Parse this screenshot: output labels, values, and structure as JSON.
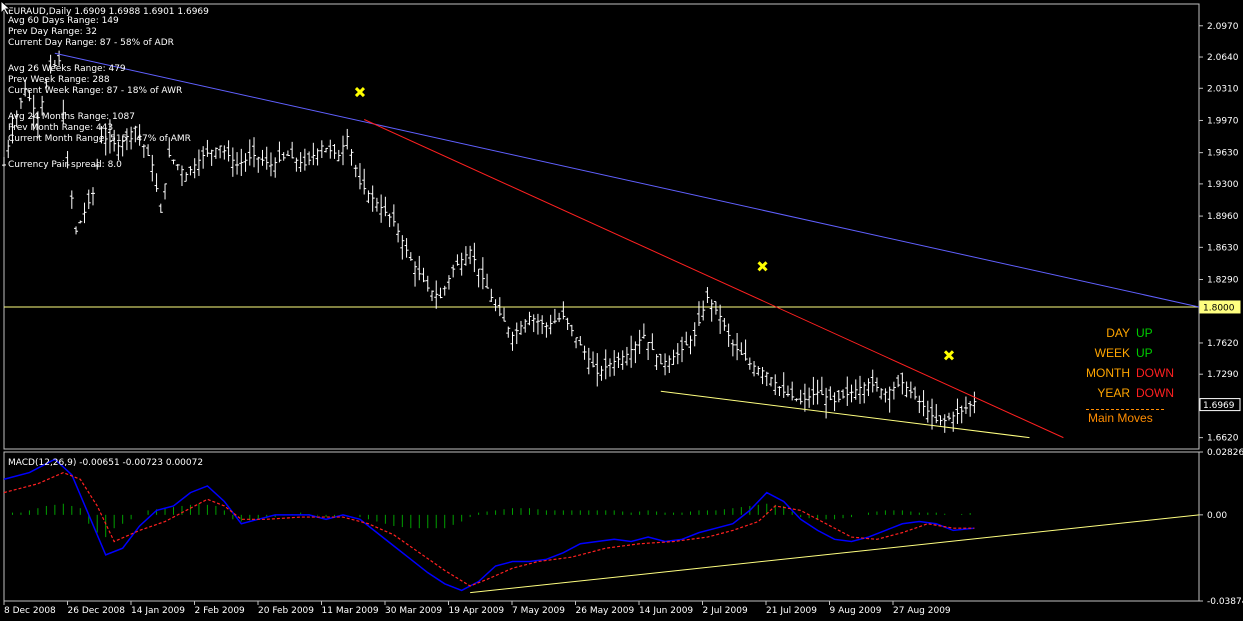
{
  "chart_data": [
    {
      "type": "ohlc",
      "title": "EURAUD,Daily  1.6909 1.6988 1.6901 1.6969",
      "symbol": "EURAUD",
      "timeframe": "Daily",
      "last_bar": {
        "open": 1.6909,
        "high": 1.6988,
        "low": 1.6901,
        "close": 1.6969
      },
      "y_ticks": [
        "2.0970",
        "2.0640",
        "2.0310",
        "1.9970",
        "1.9630",
        "1.9300",
        "1.8960",
        "1.8630",
        "1.8290",
        "1.7620",
        "1.7290",
        "1.6620"
      ],
      "ylim": [
        1.65,
        2.12
      ],
      "highlight_levels": [
        {
          "label": "1.8000",
          "value": 1.8,
          "color": "#ffff80"
        },
        {
          "label": "1.6969",
          "value": 1.6969,
          "color": "#ffffff"
        }
      ],
      "x_tick_labels": [
        "8 Dec 2008",
        "26 Dec 2008",
        "14 Jan 2009",
        "2 Feb 2009",
        "20 Feb 2009",
        "11 Mar 2009",
        "30 Mar 2009",
        "19 Apr 2009",
        "7 May 2009",
        "26 May 2009",
        "14 Jun 2009",
        "2 Jul 2009",
        "21 Jul 2009",
        "9 Aug 2009",
        "27 Aug 2009"
      ],
      "x_range_days": [
        0,
        282
      ],
      "series_path": [
        [
          0,
          1.95
        ],
        [
          2,
          1.99
        ],
        [
          5,
          2.03
        ],
        [
          8,
          2.0
        ],
        [
          11,
          2.05
        ],
        [
          13,
          2.06
        ],
        [
          15,
          1.95
        ],
        [
          17,
          1.88
        ],
        [
          19,
          1.9
        ],
        [
          21,
          1.92
        ],
        [
          23,
          1.98
        ],
        [
          27,
          1.97
        ],
        [
          31,
          1.99
        ],
        [
          35,
          1.95
        ],
        [
          37,
          1.9
        ],
        [
          39,
          1.96
        ],
        [
          43,
          1.94
        ],
        [
          47,
          1.96
        ],
        [
          51,
          1.97
        ],
        [
          55,
          1.95
        ],
        [
          59,
          1.96
        ],
        [
          63,
          1.95
        ],
        [
          67,
          1.96
        ],
        [
          71,
          1.95
        ],
        [
          75,
          1.97
        ],
        [
          79,
          1.96
        ],
        [
          81,
          1.98
        ],
        [
          84,
          1.93
        ],
        [
          88,
          1.91
        ],
        [
          92,
          1.89
        ],
        [
          96,
          1.85
        ],
        [
          100,
          1.82
        ],
        [
          103,
          1.81
        ],
        [
          106,
          1.84
        ],
        [
          110,
          1.86
        ],
        [
          113,
          1.83
        ],
        [
          116,
          1.8
        ],
        [
          120,
          1.77
        ],
        [
          124,
          1.79
        ],
        [
          128,
          1.78
        ],
        [
          132,
          1.79
        ],
        [
          136,
          1.76
        ],
        [
          140,
          1.73
        ],
        [
          143,
          1.74
        ],
        [
          147,
          1.75
        ],
        [
          151,
          1.77
        ],
        [
          155,
          1.74
        ],
        [
          159,
          1.75
        ],
        [
          163,
          1.77
        ],
        [
          166,
          1.81
        ],
        [
          169,
          1.79
        ],
        [
          172,
          1.76
        ],
        [
          176,
          1.74
        ],
        [
          180,
          1.73
        ],
        [
          184,
          1.71
        ],
        [
          188,
          1.7
        ],
        [
          192,
          1.71
        ],
        [
          196,
          1.7
        ],
        [
          200,
          1.71
        ],
        [
          204,
          1.72
        ],
        [
          208,
          1.71
        ],
        [
          212,
          1.72
        ],
        [
          216,
          1.7
        ],
        [
          220,
          1.68
        ],
        [
          222,
          1.68
        ],
        [
          226,
          1.69
        ],
        [
          229,
          1.7
        ]
      ],
      "trendlines": [
        {
          "name": "blue",
          "color": "#6060ff",
          "from": [
            12,
            2.068
          ],
          "to": [
            282,
            1.8
          ]
        },
        {
          "name": "red",
          "color": "#ff2020",
          "from": [
            85,
            1.998
          ],
          "to": [
            250,
            1.662
          ]
        },
        {
          "name": "yellow",
          "color": "#ffff80",
          "from": [
            155,
            1.711
          ],
          "to": [
            242,
            1.662
          ]
        }
      ],
      "markers": [
        {
          "name": "swing-high-1",
          "x": 84,
          "y": 2.027
        },
        {
          "name": "swing-high-2",
          "x": 179,
          "y": 1.843
        },
        {
          "name": "swing-high-3",
          "x": 223,
          "y": 1.749
        }
      ],
      "info_lines": [
        "Avg 60 Days Range: 149",
        "Prev Day Range: 32",
        "Current Day Range: 87 - 58% of ADR",
        "",
        "Avg 26 Weeks Range: 479",
        "Prev Week Range: 288",
        "Current Week Range: 87 - 18% of AWR",
        "",
        "Avg 24 Months Range: 1087",
        "Prev Month Range: 443",
        "Current Month Range: 515 - 47% of AMR",
        "",
        "Currency Pair spread: 8.0"
      ]
    },
    {
      "type": "macd",
      "title": "MACD(12,26,9) -0.00651 -0.00723 0.00072",
      "params": "12,26,9",
      "values": {
        "macd": -0.00651,
        "signal": -0.00723,
        "histogram": 0.00072
      },
      "y_ticks": [
        "0.02826",
        "0.00",
        "-0.03874"
      ],
      "ylim": [
        -0.03874,
        0.02826
      ],
      "macd_path": [
        [
          0,
          0.016
        ],
        [
          6,
          0.019
        ],
        [
          12,
          0.025
        ],
        [
          16,
          0.018
        ],
        [
          20,
          0.0
        ],
        [
          24,
          -0.018
        ],
        [
          28,
          -0.015
        ],
        [
          32,
          -0.005
        ],
        [
          36,
          0.002
        ],
        [
          40,
          0.004
        ],
        [
          44,
          0.01
        ],
        [
          48,
          0.013
        ],
        [
          52,
          0.006
        ],
        [
          56,
          -0.004
        ],
        [
          60,
          -0.002
        ],
        [
          64,
          0.0
        ],
        [
          68,
          0.0
        ],
        [
          72,
          0.0
        ],
        [
          76,
          -0.002
        ],
        [
          80,
          0.0
        ],
        [
          84,
          -0.002
        ],
        [
          88,
          -0.008
        ],
        [
          92,
          -0.014
        ],
        [
          96,
          -0.02
        ],
        [
          100,
          -0.026
        ],
        [
          104,
          -0.031
        ],
        [
          108,
          -0.034
        ],
        [
          112,
          -0.03
        ],
        [
          116,
          -0.023
        ],
        [
          120,
          -0.021
        ],
        [
          124,
          -0.021
        ],
        [
          128,
          -0.02
        ],
        [
          132,
          -0.017
        ],
        [
          136,
          -0.013
        ],
        [
          140,
          -0.012
        ],
        [
          144,
          -0.011
        ],
        [
          148,
          -0.012
        ],
        [
          152,
          -0.01
        ],
        [
          156,
          -0.012
        ],
        [
          160,
          -0.011
        ],
        [
          164,
          -0.008
        ],
        [
          168,
          -0.006
        ],
        [
          172,
          -0.004
        ],
        [
          176,
          0.002
        ],
        [
          180,
          0.01
        ],
        [
          184,
          0.006
        ],
        [
          188,
          -0.002
        ],
        [
          192,
          -0.007
        ],
        [
          196,
          -0.011
        ],
        [
          200,
          -0.012
        ],
        [
          204,
          -0.01
        ],
        [
          208,
          -0.007
        ],
        [
          212,
          -0.004
        ],
        [
          216,
          -0.003
        ],
        [
          220,
          -0.004
        ],
        [
          224,
          -0.007
        ],
        [
          229,
          -0.006
        ]
      ],
      "signal_path": [
        [
          0,
          0.01
        ],
        [
          8,
          0.014
        ],
        [
          14,
          0.019
        ],
        [
          18,
          0.016
        ],
        [
          22,
          0.004
        ],
        [
          26,
          -0.012
        ],
        [
          32,
          -0.007
        ],
        [
          38,
          -0.003
        ],
        [
          44,
          0.003
        ],
        [
          48,
          0.007
        ],
        [
          52,
          0.004
        ],
        [
          56,
          -0.002
        ],
        [
          62,
          -0.002
        ],
        [
          70,
          -0.001
        ],
        [
          80,
          -0.001
        ],
        [
          86,
          -0.004
        ],
        [
          92,
          -0.009
        ],
        [
          98,
          -0.017
        ],
        [
          104,
          -0.025
        ],
        [
          110,
          -0.032
        ],
        [
          114,
          -0.029
        ],
        [
          120,
          -0.024
        ],
        [
          126,
          -0.021
        ],
        [
          134,
          -0.019
        ],
        [
          142,
          -0.015
        ],
        [
          150,
          -0.013
        ],
        [
          158,
          -0.012
        ],
        [
          166,
          -0.01
        ],
        [
          172,
          -0.007
        ],
        [
          178,
          -0.003
        ],
        [
          182,
          0.004
        ],
        [
          188,
          0.002
        ],
        [
          194,
          -0.004
        ],
        [
          200,
          -0.01
        ],
        [
          206,
          -0.011
        ],
        [
          212,
          -0.008
        ],
        [
          218,
          -0.004
        ],
        [
          224,
          -0.006
        ],
        [
          229,
          -0.006
        ]
      ],
      "histogram": [
        [
          6,
          0.002
        ],
        [
          10,
          0.004
        ],
        [
          14,
          0.005
        ],
        [
          18,
          0.003
        ],
        [
          20,
          -0.004
        ],
        [
          22,
          -0.008
        ],
        [
          24,
          -0.01
        ],
        [
          26,
          -0.006
        ],
        [
          28,
          -0.004
        ],
        [
          30,
          -0.002
        ],
        [
          34,
          0.002
        ],
        [
          38,
          0.003
        ],
        [
          42,
          0.004
        ],
        [
          46,
          0.005
        ],
        [
          50,
          0.004
        ],
        [
          52,
          0.002
        ],
        [
          54,
          -0.002
        ],
        [
          56,
          -0.003
        ],
        [
          60,
          -0.002
        ],
        [
          64,
          -0.001
        ],
        [
          70,
          0.001
        ],
        [
          76,
          -0.001
        ],
        [
          82,
          0.0
        ],
        [
          86,
          -0.002
        ],
        [
          88,
          -0.003
        ],
        [
          92,
          -0.005
        ],
        [
          96,
          -0.006
        ],
        [
          100,
          -0.006
        ],
        [
          104,
          -0.006
        ],
        [
          108,
          -0.003
        ],
        [
          112,
          0.001
        ],
        [
          116,
          0.002
        ],
        [
          120,
          0.003
        ],
        [
          124,
          0.003
        ],
        [
          128,
          0.002
        ],
        [
          132,
          0.002
        ],
        [
          136,
          0.002
        ],
        [
          140,
          0.002
        ],
        [
          144,
          0.002
        ],
        [
          148,
          0.001
        ],
        [
          152,
          0.002
        ],
        [
          156,
          0.001
        ],
        [
          160,
          0.001
        ],
        [
          164,
          0.002
        ],
        [
          168,
          0.002
        ],
        [
          172,
          0.003
        ],
        [
          176,
          0.004
        ],
        [
          180,
          0.005
        ],
        [
          184,
          0.004
        ],
        [
          188,
          -0.001
        ],
        [
          192,
          -0.002
        ],
        [
          196,
          -0.002
        ],
        [
          200,
          -0.001
        ],
        [
          204,
          0.001
        ],
        [
          208,
          0.002
        ],
        [
          212,
          0.002
        ],
        [
          216,
          0.001
        ],
        [
          220,
          0.001
        ],
        [
          224,
          0.0
        ],
        [
          229,
          0.001
        ]
      ],
      "trendlines": [
        {
          "name": "yellow",
          "color": "#ffff80",
          "from": [
            110,
            -0.035
          ],
          "to": [
            282,
            0.0
          ]
        }
      ]
    }
  ],
  "trend_panel": {
    "rows": [
      {
        "label": "DAY",
        "value": "UP",
        "dir": "up"
      },
      {
        "label": "WEEK",
        "value": "UP",
        "dir": "up"
      },
      {
        "label": "MONTH",
        "value": "DOWN",
        "dir": "down"
      },
      {
        "label": "YEAR",
        "value": "DOWN",
        "dir": "down"
      }
    ],
    "footer": "Main Moves"
  },
  "colors": {
    "background": "#000000",
    "bars": "#ffffff",
    "grid": "#c0c0c0",
    "macd": "#0000ff",
    "signal": "#ff2020",
    "histogram": "#00a000",
    "marker": "#ffff00"
  }
}
